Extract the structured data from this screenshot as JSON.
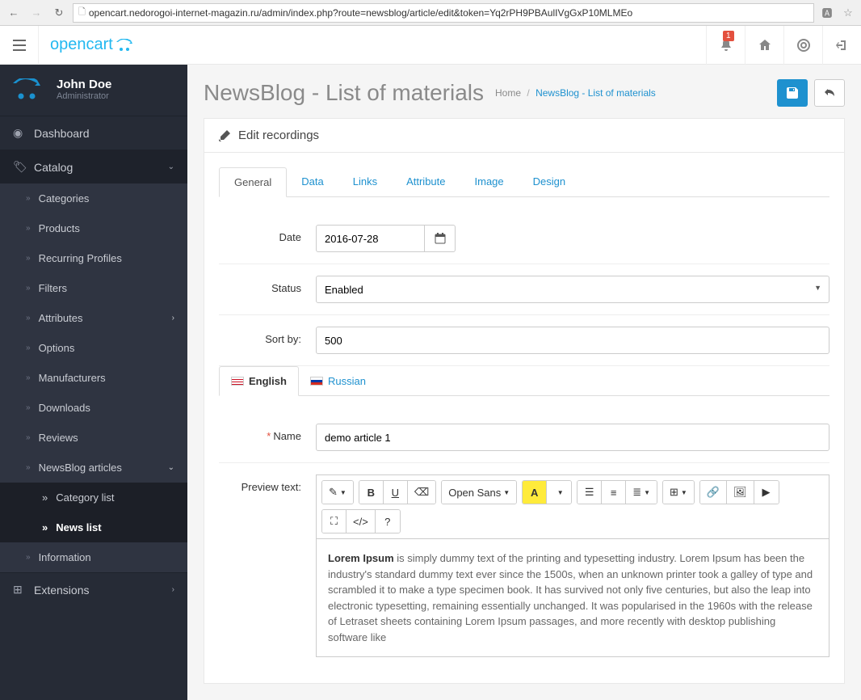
{
  "browser": {
    "url": "opencart.nedorogoi-internet-magazin.ru/admin/index.php?route=newsblog/article/edit&token=Yq2rPH9PBAulIVgGxP10MLMEo"
  },
  "topbar": {
    "logo_text": "opencart",
    "notif_count": "1"
  },
  "profile": {
    "name": "John Doe",
    "role": "Administrator"
  },
  "menu": {
    "dashboard": "Dashboard",
    "catalog": "Catalog",
    "catalog_items": {
      "categories": "Categories",
      "products": "Products",
      "recurring": "Recurring Profiles",
      "filters": "Filters",
      "attributes": "Attributes",
      "options": "Options",
      "manufacturers": "Manufacturers",
      "downloads": "Downloads",
      "reviews": "Reviews",
      "newsblog": "NewsBlog articles",
      "newsblog_sub": {
        "category_list": "Category list",
        "news_list": "News list"
      },
      "information": "Information"
    },
    "extensions": "Extensions"
  },
  "page": {
    "title": "NewsBlog - List of materials",
    "crumb_home": "Home",
    "crumb_current": "NewsBlog - List of materials"
  },
  "panel": {
    "heading": "Edit recordings"
  },
  "tabs": {
    "general": "General",
    "data": "Data",
    "links": "Links",
    "attribute": "Attribute",
    "image": "Image",
    "design": "Design"
  },
  "form": {
    "date_label": "Date",
    "date_value": "2016-07-28",
    "status_label": "Status",
    "status_value": "Enabled",
    "sort_label": "Sort by:",
    "sort_value": "500",
    "lang_en": "English",
    "lang_ru": "Russian",
    "name_label": "Name",
    "name_value": "demo article 1",
    "preview_label": "Preview text:",
    "font_family": "Open Sans",
    "content_bold": "Lorem Ipsum",
    "content_rest": " is simply dummy text of the printing and typesetting industry. Lorem Ipsum has been the industry's standard dummy text ever since the 1500s, when an unknown printer took a galley of type and scrambled it to make a type specimen book. It has survived not only five centuries, but also the leap into electronic typesetting, remaining essentially unchanged. It was popularised in the 1960s with the release of Letraset sheets containing Lorem Ipsum passages, and more recently with desktop publishing software like"
  }
}
